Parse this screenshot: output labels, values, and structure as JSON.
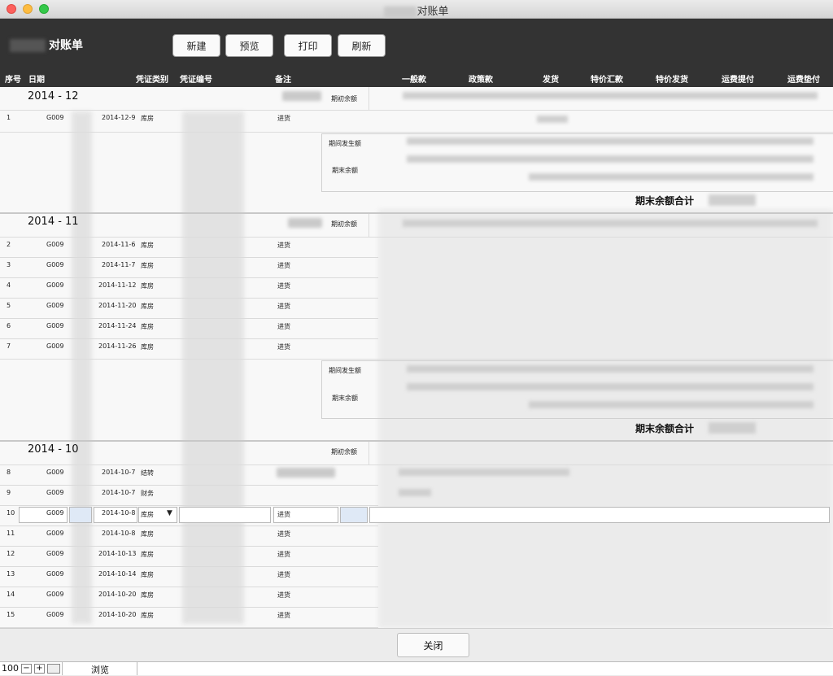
{
  "window": {
    "title": "对账单"
  },
  "header": {
    "title": "对账单",
    "buttons": {
      "new": "新建",
      "preview": "预览",
      "print": "打印",
      "refresh": "刷新"
    }
  },
  "columns": [
    "序号",
    "日期",
    "凭证类别",
    "凭证编号",
    "备注",
    "一般款",
    "政策款",
    "发货",
    "特价汇款",
    "特价发货",
    "运费提付",
    "运费垫付"
  ],
  "labels": {
    "opening_balance": "期初余额",
    "period_amount": "期间发生额",
    "closing_balance": "期末余额",
    "closing_total": "期末余额合计"
  },
  "periods": [
    {
      "title": "2014 - 12",
      "rows": [
        {
          "no": "1",
          "code": "G009",
          "date": "2014-12-9",
          "type": "库房",
          "remark": "进货"
        }
      ]
    },
    {
      "title": "2014 - 11",
      "rows": [
        {
          "no": "2",
          "code": "G009",
          "date": "2014-11-6",
          "type": "库房",
          "remark": "进货"
        },
        {
          "no": "3",
          "code": "G009",
          "date": "2014-11-7",
          "type": "库房",
          "remark": "进货"
        },
        {
          "no": "4",
          "code": "G009",
          "date": "2014-11-12",
          "type": "库房",
          "remark": "进货"
        },
        {
          "no": "5",
          "code": "G009",
          "date": "2014-11-20",
          "type": "库房",
          "remark": "进货"
        },
        {
          "no": "6",
          "code": "G009",
          "date": "2014-11-24",
          "type": "库房",
          "remark": "进货"
        },
        {
          "no": "7",
          "code": "G009",
          "date": "2014-11-26",
          "type": "库房",
          "remark": "进货"
        }
      ]
    },
    {
      "title": "2014 - 10",
      "rows": [
        {
          "no": "8",
          "code": "G009",
          "date": "2014-10-7",
          "type": "结转",
          "remark": ""
        },
        {
          "no": "9",
          "code": "G009",
          "date": "2014-10-7",
          "type": "财务",
          "remark": ""
        },
        {
          "no": "10",
          "code": "G009",
          "date": "2014-10-8",
          "type": "库房",
          "remark": "进货"
        },
        {
          "no": "11",
          "code": "G009",
          "date": "2014-10-8",
          "type": "库房",
          "remark": "进货"
        },
        {
          "no": "12",
          "code": "G009",
          "date": "2014-10-13",
          "type": "库房",
          "remark": "进货"
        },
        {
          "no": "13",
          "code": "G009",
          "date": "2014-10-14",
          "type": "库房",
          "remark": "进货"
        },
        {
          "no": "14",
          "code": "G009",
          "date": "2014-10-20",
          "type": "库房",
          "remark": "进货"
        },
        {
          "no": "15",
          "code": "G009",
          "date": "2014-10-20",
          "type": "库房",
          "remark": "进货"
        }
      ]
    }
  ],
  "footer": {
    "close": "关闭"
  },
  "status": {
    "zoom": "100",
    "mode": "浏览"
  },
  "colors": {
    "header_bg": "#333333",
    "content_bg": "#f8f8f8"
  }
}
